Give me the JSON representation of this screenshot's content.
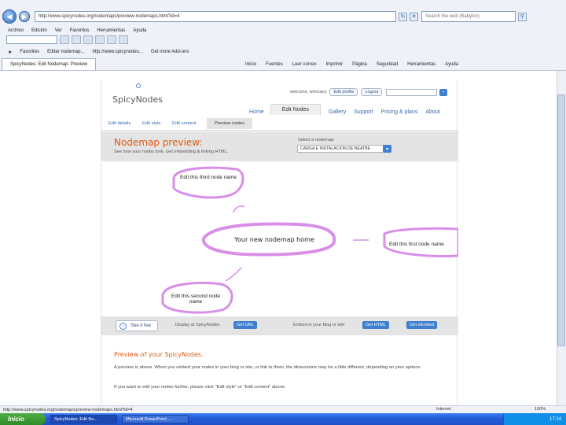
{
  "browser": {
    "address": "http://www.spicynodes.org/nodemaps/preview-nodemaps.html?id=4",
    "search_placeholder": "Search the web (Babylon)",
    "menu": [
      "Archivo",
      "Edición",
      "Ver",
      "Favoritos",
      "Herramientas",
      "Ayuda"
    ],
    "favorites_label": "Favorites",
    "fav_links": [
      "Editar nodemap...",
      "http://www.spicynodes...",
      "Get more Add-ons"
    ],
    "tab_title": "SpicyNodes: Edit Nodemap: Preview",
    "commands": [
      "Inicio",
      "Fuentes",
      "Leer correo",
      "Imprimir",
      "Página",
      "Seguridad",
      "Herramientas",
      "Ayuda"
    ]
  },
  "site": {
    "logo": "SpicyNodes",
    "welcome": "welcome, wechany",
    "edit_profile": "Edit profile",
    "logout": "Logout",
    "main_nav": [
      "Home",
      "Edit Nodes",
      "Gallery",
      "Support",
      "Pricing & plans",
      "About"
    ],
    "sub_nav": [
      "Edit details",
      "Edit style",
      "Edit content",
      "Preview nodes"
    ],
    "banner_title": "Nodemap preview:",
    "banner_sub": "See how your nodes look. Get embedding & linking HTML.",
    "select_label": "Select a nodemap:",
    "select_value": "CARGA E INSTALACION DE NEATBE"
  },
  "map": {
    "home_node": "Your new nodemap home",
    "node_third": "Edit this third node name",
    "node_first": "Edit this first node name",
    "node_second": "Edit this second node name",
    "accent": "#d98ee8"
  },
  "embed": {
    "see_live": "See it live",
    "display_label": "Display at SpicyNodes:",
    "get_url": "Get URL",
    "embed_label": "Embed in your blog or site:",
    "get_html": "Get HTML",
    "get_embed": "Get eEmbed"
  },
  "preview": {
    "title": "Preview of your SpicyNodes.",
    "text1": "A preview is above. When you embed your nodes in your blog or site, or link to them, the dimensions may be a little different, depending on your options.",
    "text2": "If you want to edit your nodes further, please click \"Edit style\" or \"Edit content\" above."
  },
  "status": {
    "url": "http://www.spicynodes.org/nodemaps/preview-nodemaps.html?id=4",
    "zone": "Internet",
    "zoom": "100%"
  },
  "taskbar": {
    "start": "Inicio",
    "tasks": [
      "SpicyNodes: Edit No...",
      "Microsoft PowerPoint ..."
    ],
    "clock": "17:14"
  }
}
